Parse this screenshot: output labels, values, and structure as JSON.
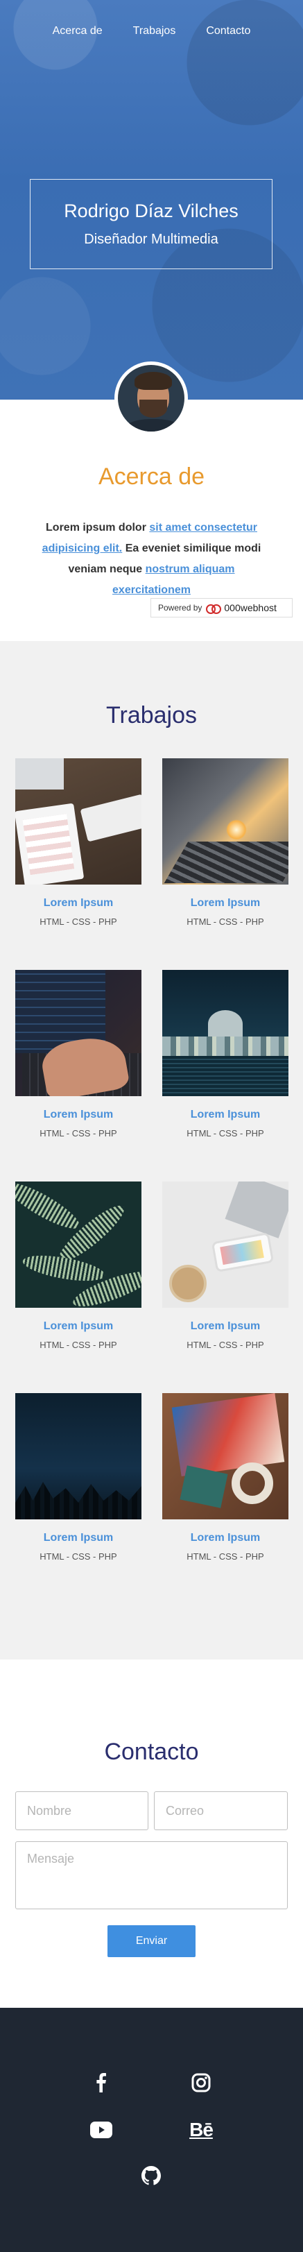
{
  "nav": {
    "items": [
      "Acerca de",
      "Trabajos",
      "Contacto"
    ]
  },
  "hero": {
    "name": "Rodrigo Díaz Vilches",
    "role": "Diseñador Multimedia"
  },
  "about": {
    "title": "Acerca de",
    "text_1": "Lorem ipsum dolor ",
    "link_1": "sit amet consectetur adipisicing elit.",
    "text_2": " Ea eveniet similique modi veniam neque ",
    "link_2": "nostrum aliquam exercitationem",
    "powered_label": "Powered by",
    "powered_brand": "000webhost"
  },
  "works": {
    "title": "Trabajos",
    "items": [
      {
        "title": "Lorem Ipsum",
        "tags": "HTML - CSS - PHP",
        "image": "desk-tablet-keyboard"
      },
      {
        "title": "Lorem Ipsum",
        "tags": "HTML - CSS - PHP",
        "image": "railway-sunset"
      },
      {
        "title": "Lorem Ipsum",
        "tags": "HTML - CSS - PHP",
        "image": "laptop-typing"
      },
      {
        "title": "Lorem Ipsum",
        "tags": "HTML - CSS - PHP",
        "image": "city-night-dome"
      },
      {
        "title": "Lorem Ipsum",
        "tags": "HTML - CSS - PHP",
        "image": "fern-leaves"
      },
      {
        "title": "Lorem Ipsum",
        "tags": "HTML - CSS - PHP",
        "image": "phone-laptop-coffee"
      },
      {
        "title": "Lorem Ipsum",
        "tags": "HTML - CSS - PHP",
        "image": "night-sky-trees"
      },
      {
        "title": "Lorem Ipsum",
        "tags": "HTML - CSS - PHP",
        "image": "craft-desk"
      }
    ]
  },
  "contact": {
    "title": "Contacto",
    "name_placeholder": "Nombre",
    "email_placeholder": "Correo",
    "message_placeholder": "Mensaje",
    "send_label": "Enviar"
  },
  "footer": {
    "icons": [
      "facebook-icon",
      "instagram-icon",
      "youtube-icon",
      "behance-icon",
      "github-icon"
    ],
    "behance_glyph": "Bē"
  },
  "colors": {
    "hero_blue": "#3f72b6",
    "accent_orange": "#e89a2e",
    "link_blue": "#4a90d9",
    "heading_navy": "#2a2e6e",
    "button_blue": "#3f8fe0",
    "footer_dark": "#1f2733"
  }
}
